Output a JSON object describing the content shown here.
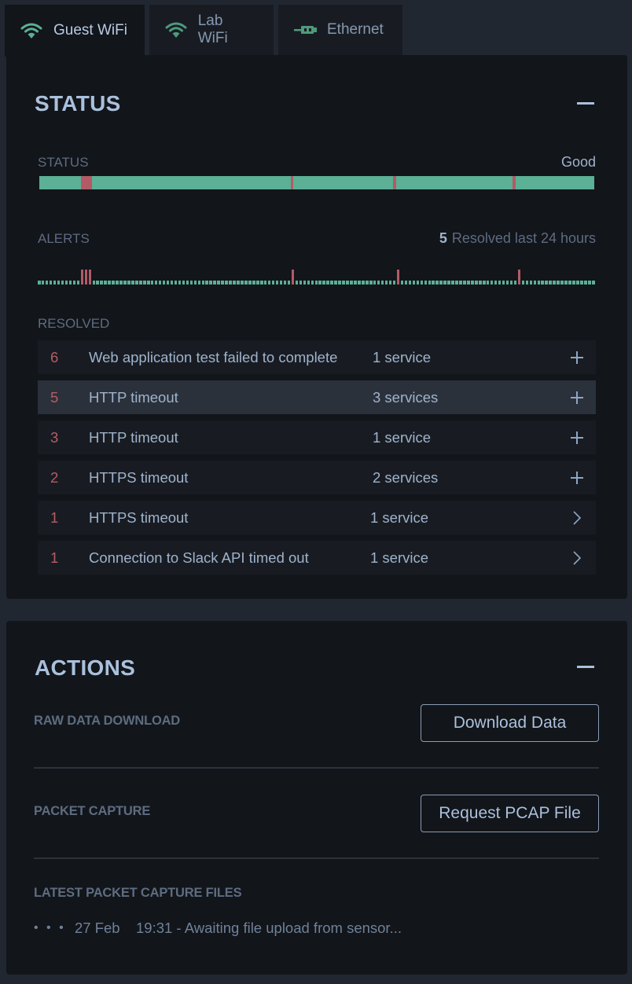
{
  "tabs": [
    {
      "label": "Guest WiFi",
      "icon": "wifi-icon",
      "active": true
    },
    {
      "label": "Lab WiFi",
      "icon": "wifi-icon",
      "active": false
    },
    {
      "label": "Ethernet",
      "icon": "ethernet-icon",
      "active": false
    }
  ],
  "colors": {
    "good": "#5bb095",
    "bad": "#b25b66",
    "count": "#b55c63",
    "accent_text": "#aac0dc"
  },
  "status_panel": {
    "title": "STATUS",
    "status_label": "STATUS",
    "status_value": "Good",
    "status_timeline_incidents": [
      {
        "start_pct": 7.5,
        "end_pct": 9.5
      },
      {
        "start_pct": 45.3,
        "end_pct": 45.8
      },
      {
        "start_pct": 63.7,
        "end_pct": 64.3
      },
      {
        "start_pct": 85.3,
        "end_pct": 85.9
      }
    ],
    "alerts_label": "ALERTS",
    "alerts_count": "5",
    "alerts_summary": "Resolved last 24 hours",
    "alert_ticks_total": 143,
    "alert_ticks_red": [
      11,
      12,
      13,
      65,
      92,
      123
    ],
    "resolved_label": "RESOLVED",
    "resolved": [
      {
        "count": "6",
        "name": "Web application test failed to complete",
        "services": "1 service",
        "action": "plus",
        "highlighted": false
      },
      {
        "count": "5",
        "name": "HTTP timeout",
        "services": "3 services",
        "action": "plus",
        "highlighted": true
      },
      {
        "count": "3",
        "name": "HTTP timeout",
        "services": "1 service",
        "action": "plus",
        "highlighted": false
      },
      {
        "count": "2",
        "name": "HTTPS timeout",
        "services": "2 services",
        "action": "plus",
        "highlighted": false
      },
      {
        "count": "1",
        "name": "HTTPS timeout",
        "services": "1 service",
        "action": "chevron",
        "highlighted": false
      },
      {
        "count": "1",
        "name": "Connection to Slack API timed out",
        "services": "1 service",
        "action": "chevron",
        "highlighted": false
      }
    ]
  },
  "actions_panel": {
    "title": "ACTIONS",
    "raw_data_label": "RAW DATA DOWNLOAD",
    "download_button": "Download Data",
    "packet_capture_label": "PACKET CAPTURE",
    "pcap_button": "Request PCAP File",
    "latest_files_label": "LATEST PACKET CAPTURE FILES",
    "files": [
      {
        "menu": "• • •",
        "date": "27 Feb",
        "text": "19:31 - Awaiting file upload from sensor..."
      }
    ]
  }
}
